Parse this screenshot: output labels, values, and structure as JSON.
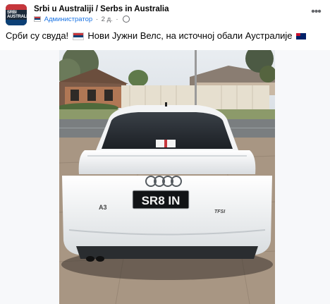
{
  "post": {
    "page_name": "Srbi u Australiji / Serbs in Australia",
    "role_badge": "Администратор",
    "time": "2 д.",
    "caption_part1": "Срби су свуда!",
    "caption_part2": "Нови Јужни Велс, на источној обали Аустралије",
    "avatar_text": "SRBI AUSTRALIA"
  },
  "photo": {
    "plate_text": "SR8 IN",
    "model_badge": "A3",
    "trim_badge": "TFSI"
  },
  "colors": {
    "text_primary": "#050505",
    "text_secondary": "#65676b",
    "accent": "#1b74e4",
    "background": "#ffffff"
  },
  "icons": {
    "more": "ellipsis-icon",
    "privacy": "globe-icon",
    "flag_serbia": "serbia-flag-icon",
    "flag_australia": "australia-flag-icon"
  }
}
